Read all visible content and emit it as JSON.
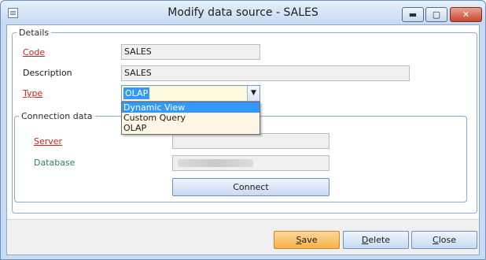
{
  "window": {
    "title": "Modify data source - SALES",
    "controls": {
      "minimize": "▬",
      "maximize": "▢",
      "close": "✕"
    }
  },
  "details": {
    "legend": "Details",
    "code": {
      "label": "Code",
      "value": "SALES"
    },
    "description": {
      "label": "Description",
      "value": "SALES"
    },
    "type": {
      "label": "Type",
      "value": "OLAP",
      "options": [
        "Dynamic View",
        "Custom Query",
        "OLAP"
      ],
      "highlighted": "Dynamic View"
    }
  },
  "connection": {
    "legend": "Connection data",
    "server": {
      "label": "Server",
      "value": ""
    },
    "database": {
      "label": "Database"
    },
    "connect_label": "Connect"
  },
  "footer": {
    "save_label": "Save",
    "delete_label": "Delete",
    "close_label": "Close"
  },
  "colors": {
    "required_label": "#c8261e",
    "database_label": "#2f7f6e",
    "selection": "#3399ff",
    "save_button": "#f7b14a"
  },
  "icons": {
    "app": "form-icon",
    "type_dropdown": "chevron-down-icon"
  }
}
